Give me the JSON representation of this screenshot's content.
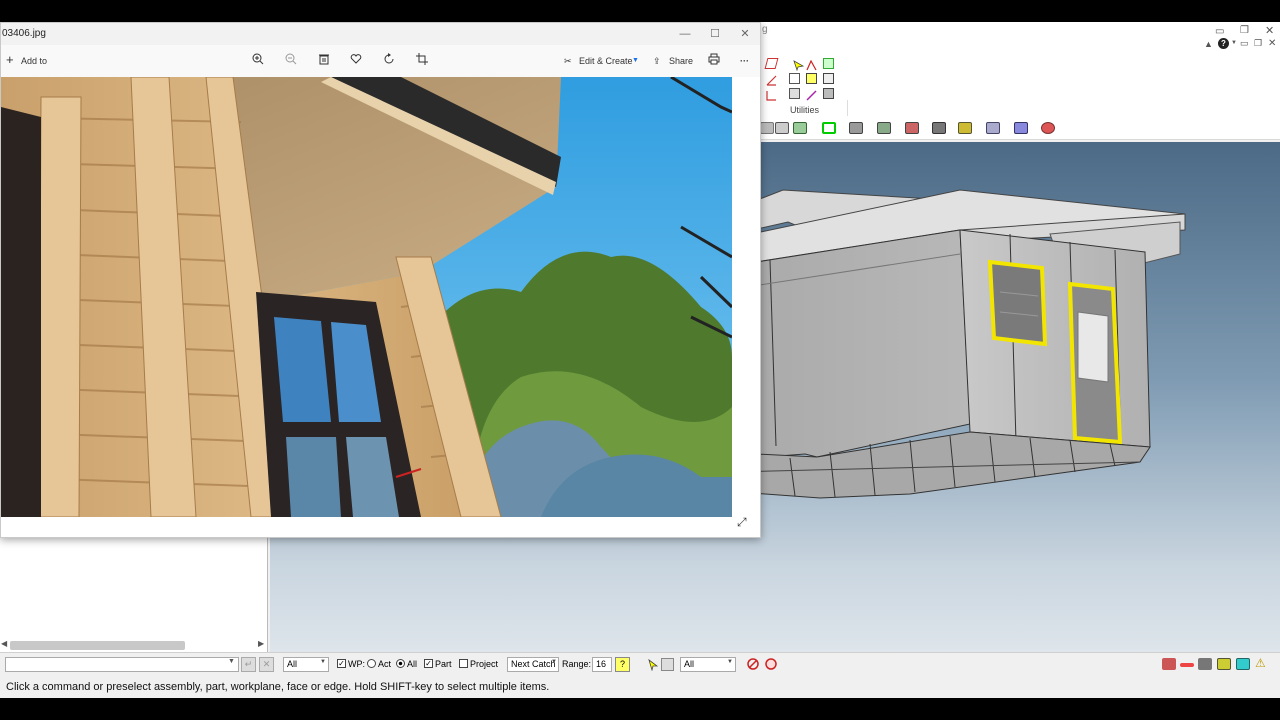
{
  "photos": {
    "filename": "03406.jpg",
    "toolbar": {
      "add_to": "Add to",
      "edit_create": "Edit & Create",
      "share": "Share",
      "more": "···"
    },
    "window_controls": {
      "minimize": "—",
      "maximize": "☐",
      "close": "✕"
    }
  },
  "cad": {
    "title_fragment": "g",
    "ribbon_group": "Utilities"
  },
  "cmdbar": {
    "filter_value": "All",
    "wp_label": "WP:",
    "act_label": "Act",
    "all_label": "All",
    "part_label": "Part",
    "project_label": "Project",
    "next_catch": "Next Catch",
    "range_label": "Range:",
    "range_value": "16",
    "selector_value": "All"
  },
  "status": {
    "message": "Click a command or preselect assembly, part, workplane, face or edge. Hold SHIFT-key to select multiple items."
  },
  "colors": {
    "accent_yellow": "#f2e600",
    "viewport_top": "#4c6a86",
    "viewport_bottom": "#e3e9ee"
  }
}
